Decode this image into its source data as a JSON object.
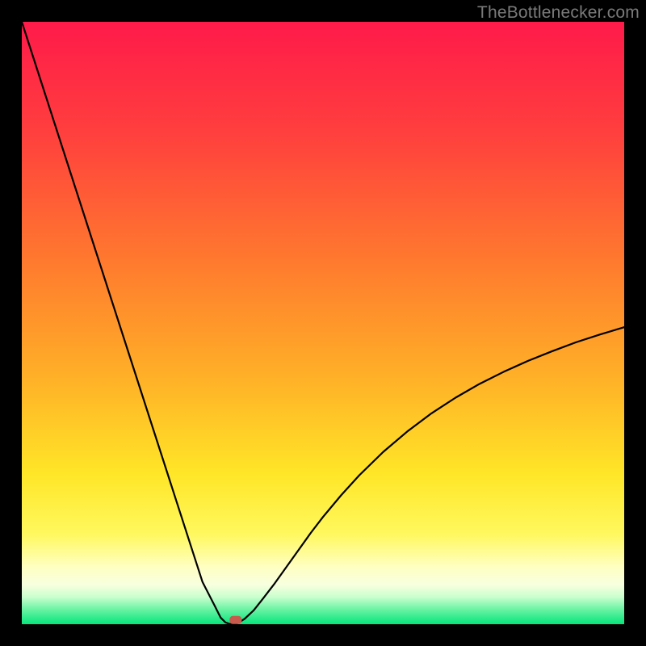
{
  "attribution": "TheBottlenecker.com",
  "palette": {
    "top_red": "#ff1a4a",
    "mid_orange": "#ff8a2a",
    "yellow": "#ffe627",
    "pale_yellow": "#ffffbf",
    "green": "#06e57b",
    "black": "#000000",
    "marker": "#c85a4d"
  },
  "chart_data": {
    "type": "line",
    "title": "",
    "xlabel": "",
    "ylabel": "",
    "xlim": [
      0,
      100
    ],
    "ylim": [
      0,
      100
    ],
    "x": [
      0,
      2,
      4,
      6,
      8,
      10,
      12,
      14,
      16,
      18,
      20,
      22,
      24,
      26,
      28,
      30,
      32,
      33,
      33.8,
      34.5,
      35,
      35.5,
      36,
      37,
      38.5,
      40,
      42,
      44,
      46,
      48,
      50,
      53,
      56,
      60,
      64,
      68,
      72,
      76,
      80,
      84,
      88,
      92,
      96,
      100
    ],
    "values": [
      100,
      93.8,
      87.6,
      81.4,
      75.2,
      69,
      62.8,
      56.6,
      50.4,
      44.2,
      38,
      31.8,
      25.6,
      19.4,
      13.2,
      7,
      3.1,
      1.1,
      0.3,
      0.05,
      0,
      0.05,
      0.25,
      0.9,
      2.3,
      4.2,
      6.8,
      9.6,
      12.4,
      15.2,
      17.8,
      21.4,
      24.7,
      28.6,
      32,
      35,
      37.6,
      39.9,
      41.9,
      43.7,
      45.3,
      46.8,
      48.1,
      49.3
    ],
    "marker": {
      "x": 35.5,
      "y": 0.7
    },
    "gradient_stops": [
      {
        "offset": 0.0,
        "color": "#ff1a4a"
      },
      {
        "offset": 0.18,
        "color": "#ff3e3e"
      },
      {
        "offset": 0.4,
        "color": "#ff7a2e"
      },
      {
        "offset": 0.6,
        "color": "#ffb327"
      },
      {
        "offset": 0.75,
        "color": "#ffe627"
      },
      {
        "offset": 0.85,
        "color": "#fff85e"
      },
      {
        "offset": 0.905,
        "color": "#ffffc2"
      },
      {
        "offset": 0.935,
        "color": "#f7ffdf"
      },
      {
        "offset": 0.955,
        "color": "#c9ffce"
      },
      {
        "offset": 0.975,
        "color": "#6cf3a4"
      },
      {
        "offset": 1.0,
        "color": "#06e57b"
      }
    ]
  }
}
